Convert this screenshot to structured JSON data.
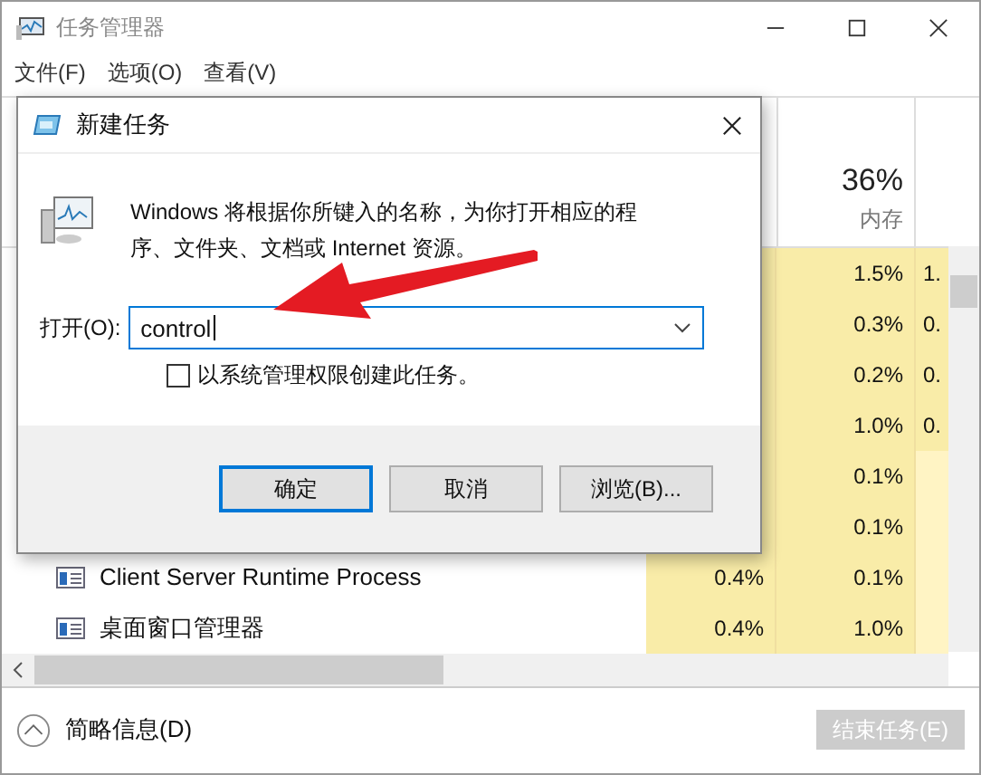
{
  "window": {
    "title": "任务管理器"
  },
  "menu": [
    "文件(F)",
    "选项(O)",
    "查看(V)"
  ],
  "table": {
    "memory_header": {
      "value": "36%",
      "label": "内存"
    },
    "rows": [
      {
        "name": "",
        "memory": "1.5%",
        "column_3": "1.",
        "heavy": true
      },
      {
        "memory": "0.3%",
        "column_3": "0.",
        "heavy": true
      },
      {
        "memory": "0.2%",
        "column_3": "0.",
        "heavy": true
      },
      {
        "memory": "1.0%",
        "column_3": "0.",
        "heavy": true
      },
      {
        "memory": "0.1%",
        "heavy": false
      },
      {
        "memory": "0.1%",
        "heavy": false
      },
      {
        "name": "Client Server Runtime Process",
        "cpu": "0.4%",
        "memory": "0.1%",
        "heavy": false
      },
      {
        "name": "桌面窗口管理器",
        "cpu": "0.4%",
        "memory": "1.0%",
        "heavy": false
      }
    ]
  },
  "footer": {
    "details": "简略信息(D)",
    "end_task": {
      "label": "结束任务(E)",
      "disabled": true
    }
  },
  "dialog": {
    "title": "新建任务",
    "message": "Windows 将根据你所键入的名称，为你打开相应的程序、文件夹、文档或 Internet 资源。",
    "open_label": "打开(O):",
    "open_value": "control",
    "admin_checkbox": {
      "label": "以系统管理权限创建此任务。",
      "checked": false
    },
    "buttons": [
      {
        "label": "确定",
        "selected": true
      },
      {
        "label": "取消",
        "selected": false
      },
      {
        "label": "浏览(B)...",
        "selected": false
      }
    ]
  }
}
